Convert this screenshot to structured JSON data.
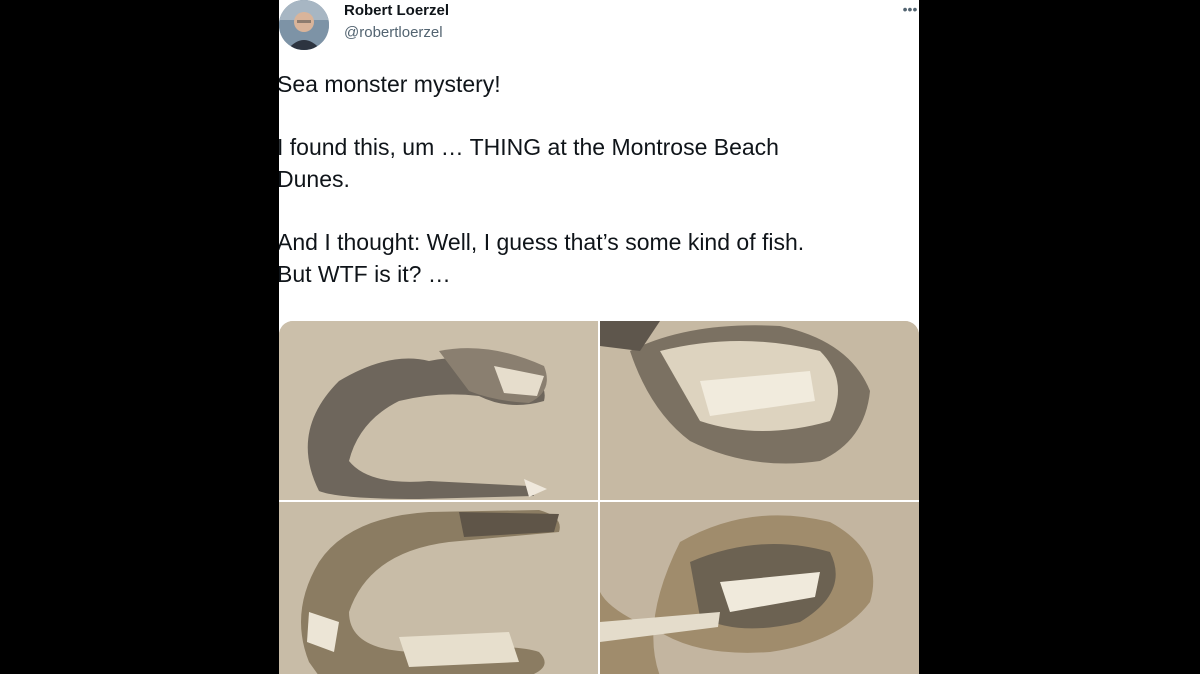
{
  "tweet": {
    "author_name": "Robert Loerzel",
    "author_handle": "@robertloerzel",
    "more_icon": "more-horizontal-icon",
    "paragraphs": [
      "Sea monster mystery!",
      "I found this, um … THING at the Montrose Beach\nDunes.",
      "And I thought: Well, I guess that’s some kind of fish.\nBut WTF is it? …"
    ],
    "photos_count": 4
  },
  "colors": {
    "text_primary": "#0f1419",
    "text_secondary": "#536471",
    "sand": "#c9bba6",
    "background": "#000000"
  }
}
